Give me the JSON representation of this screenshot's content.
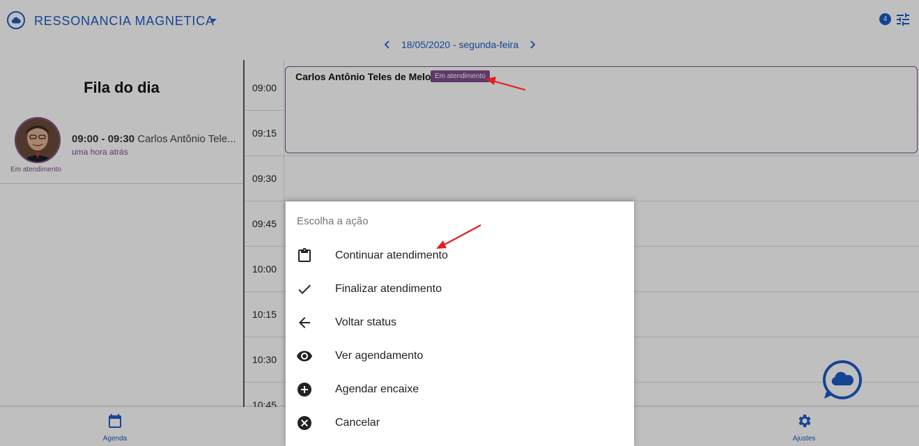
{
  "header": {
    "clinic_name": "RESSONANCIA MAGNETICA",
    "notification_count": "4",
    "date_label": "18/05/2020 - segunda-feira"
  },
  "sidebar": {
    "title": "Fila do dia",
    "queue": [
      {
        "time": "09:00 - 09:30",
        "patient": "Carlos Antônio Tele...",
        "relative_time": "uma hora atrás",
        "status": "Em atendimento"
      }
    ]
  },
  "schedule": {
    "times": [
      "09:00",
      "09:15",
      "09:30",
      "09:45",
      "10:00",
      "10:15",
      "10:30",
      "10:45"
    ],
    "appointment": {
      "patient": "Carlos Antônio Teles de Melo",
      "status": "Em atendimento"
    }
  },
  "sheet": {
    "title": "Escolha a ação",
    "actions": [
      {
        "label": "Continuar atendimento",
        "icon": "clipboard-icon"
      },
      {
        "label": "Finalizar atendimento",
        "icon": "check-icon"
      },
      {
        "label": "Voltar status",
        "icon": "arrow-left-icon"
      },
      {
        "label": "Ver agendamento",
        "icon": "eye-icon"
      },
      {
        "label": "Agendar encaixe",
        "icon": "plus-circle-icon"
      },
      {
        "label": "Cancelar",
        "icon": "close-circle-icon"
      }
    ]
  },
  "bottom_nav": {
    "agenda": "Agenda",
    "settings": "Ajustes"
  },
  "colors": {
    "brand": "#1e5bc6",
    "status_in_service": "#7c4d8a",
    "annotation_arrow": "#e02020"
  }
}
